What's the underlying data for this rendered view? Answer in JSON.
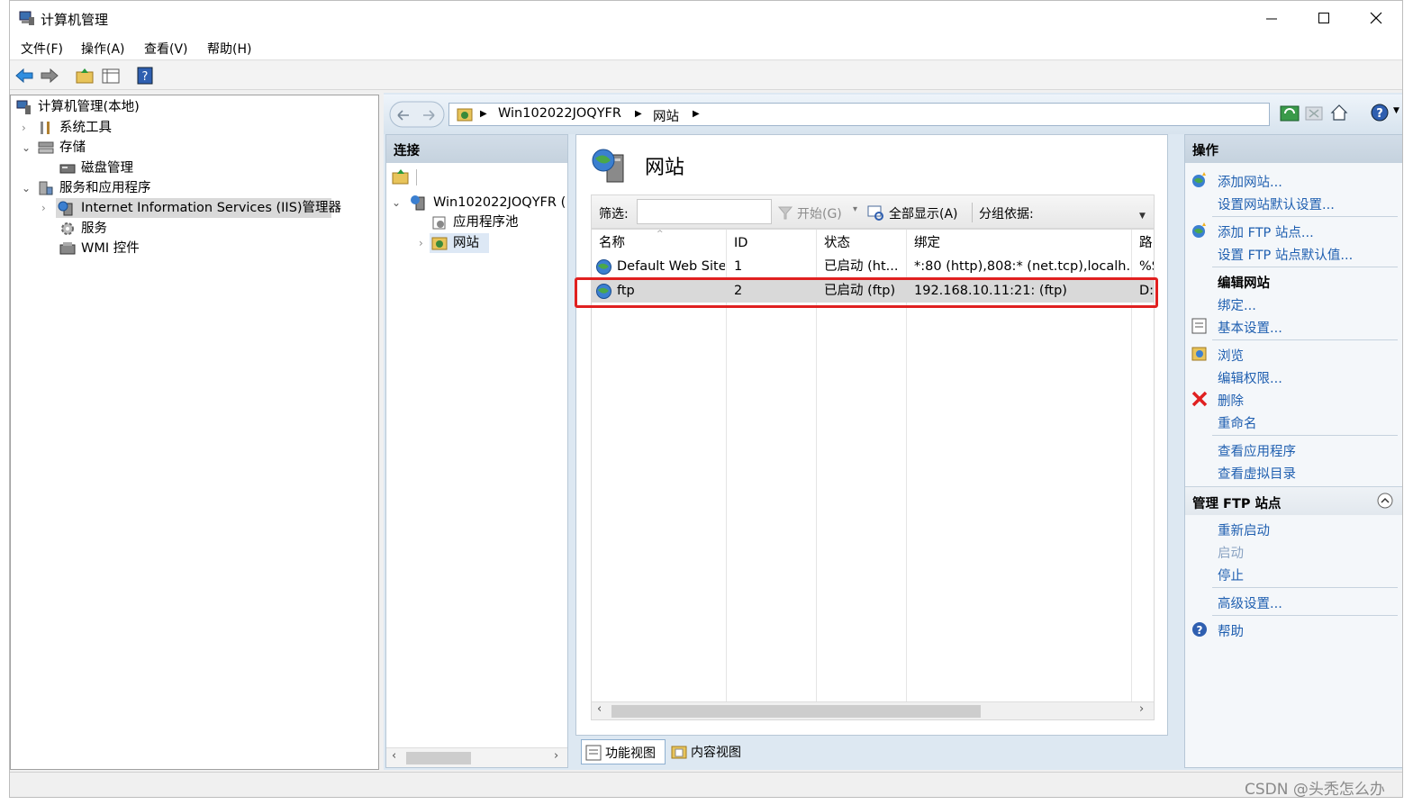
{
  "window": {
    "title": "计算机管理"
  },
  "menu": [
    "文件(F)",
    "操作(A)",
    "查看(V)",
    "帮助(H)"
  ],
  "tree": {
    "root": "计算机管理(本地)",
    "system_tools": "系统工具",
    "storage": "存储",
    "disk_mgmt": "磁盘管理",
    "services_apps": "服务和应用程序",
    "iis": "Internet Information Services (IIS)管理器",
    "services": "服务",
    "wmi": "WMI 控件"
  },
  "address": {
    "crumbs": [
      "Win102022JOQYFR",
      "网站"
    ]
  },
  "connections": {
    "header": "连接",
    "server": "Win102022JOQYFR (",
    "app_pools": "应用程序池",
    "sites": "网站"
  },
  "center": {
    "title": "网站",
    "filter_label": "筛选:",
    "filter_value": "",
    "start_label": "开始(G)",
    "show_all_label": "全部显示(A)",
    "group_by_label": "分组依据:",
    "columns": [
      "名称",
      "ID",
      "状态",
      "绑定",
      "路"
    ],
    "rows": [
      {
        "name": "Default Web Site",
        "id": "1",
        "status": "已启动 (ht...",
        "binding": "*:80 (http),808:* (net.tcp),localh...",
        "path": "%S"
      },
      {
        "name": "ftp",
        "id": "2",
        "status": "已启动 (ftp)",
        "binding": "192.168.10.11:21: (ftp)",
        "path": "D:"
      }
    ],
    "tab_features": "功能视图",
    "tab_content": "内容视图"
  },
  "actions": {
    "header": "操作",
    "add_site": "添加网站...",
    "site_defaults": "设置网站默认设置...",
    "add_ftp": "添加 FTP 站点...",
    "ftp_defaults": "设置 FTP 站点默认值...",
    "edit_site": "编辑网站",
    "bindings": "绑定...",
    "basic_settings": "基本设置...",
    "browse": "浏览",
    "edit_perms": "编辑权限...",
    "delete": "删除",
    "rename": "重命名",
    "view_apps": "查看应用程序",
    "view_vdirs": "查看虚拟目录",
    "manage_ftp": "管理 FTP 站点",
    "restart": "重新启动",
    "start": "启动",
    "stop": "停止",
    "advanced": "高级设置...",
    "help": "帮助"
  },
  "watermark": "CSDN @头秃怎么办",
  "colors": {
    "link": "#1f5fb0",
    "highlight": "#e02020",
    "selected_row": "#d9d9d9"
  }
}
